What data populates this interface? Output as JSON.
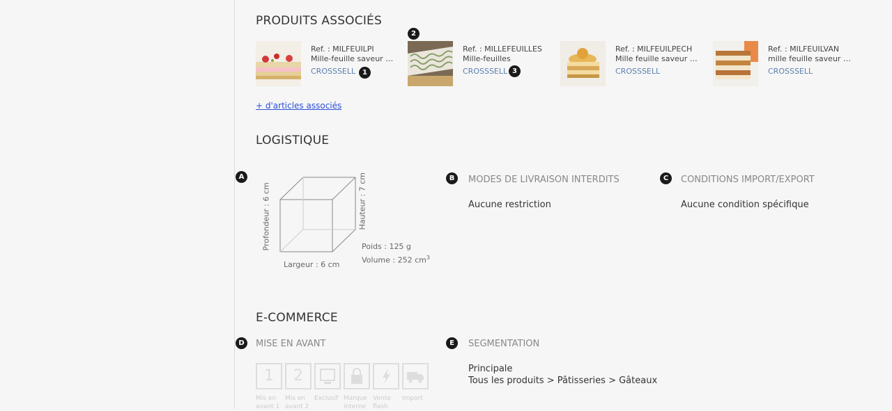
{
  "related": {
    "title": "PRODUITS ASSOCIÉS",
    "more_link": "+ d'articles associés",
    "items": [
      {
        "ref": "Ref. : MILFEUILPI",
        "desc": "Mille-feuille saveur pi…",
        "type": "CROSSSELL"
      },
      {
        "ref": "Ref. : MILLEFEUILLES",
        "desc": "Mille-feuilles",
        "type": "CROSSSELL"
      },
      {
        "ref": "Ref. : MILFEUILPECH",
        "desc": "Mille feuille saveur p…",
        "type": "CROSSSELL"
      },
      {
        "ref": "Ref. : MILFEUILVAN",
        "desc": "mille feuille saveur V…",
        "type": "CROSSSELL"
      }
    ],
    "markers": [
      "1",
      "2",
      "3"
    ]
  },
  "logistics": {
    "title": "LOGISTIQUE",
    "markers": [
      "A",
      "B",
      "C"
    ],
    "depth": "Profondeur : 6 cm",
    "height": "Hauteur : 7 cm",
    "width": "Largeur : 6 cm",
    "weight": "Poids : 125 g",
    "volume": "Volume : 252 cm",
    "volume_exp": "3",
    "delivery_title": "MODES DE LIVRAISON INTERDITS",
    "delivery_value": "Aucune restriction",
    "import_title": "CONDITIONS IMPORT/EXPORT",
    "import_value": "Aucune condition spécifique"
  },
  "ecommerce": {
    "title": "E-COMMERCE",
    "markers": [
      "D",
      "E"
    ],
    "highlight_title": "MISE EN AVANT",
    "features": [
      {
        "glyph": "1",
        "label": "Mis en avant 1",
        "icon": "number-1-icon"
      },
      {
        "glyph": "2",
        "label": "Mis en avant 2",
        "icon": "number-2-icon"
      },
      {
        "glyph": "",
        "label": "Exclusif",
        "icon": "screen-icon"
      },
      {
        "glyph": "",
        "label": "Marque interne",
        "icon": "lock-icon"
      },
      {
        "glyph": "",
        "label": "Vente flash",
        "icon": "lightning-icon"
      },
      {
        "glyph": "",
        "label": "Import",
        "icon": "truck-icon"
      }
    ],
    "segmentation_title": "SEGMENTATION",
    "segmentation_label": "Principale",
    "segmentation_path": "Tous les produits > Pâtisseries > Gâteaux"
  }
}
